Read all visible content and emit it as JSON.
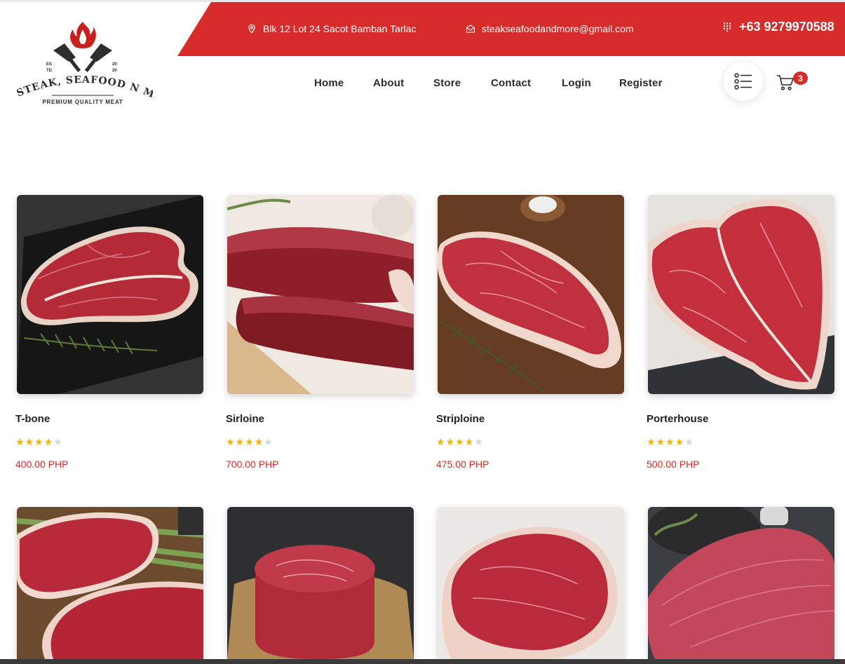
{
  "topbar": {
    "address": "Blk 12 Lot 24 Sacot Bamban Tarlac",
    "email": "steakseafoodandmore@gmail.com",
    "phone": "+63 9279970588"
  },
  "logo": {
    "brand": "STEAK, SEAFOOD N MORE",
    "tagline": "PREMIUM QUALITY MEAT",
    "est_left": "ES\nTD",
    "est_right": "20\n20"
  },
  "nav": {
    "items": [
      "Home",
      "About",
      "Store",
      "Contact",
      "Login",
      "Register"
    ]
  },
  "cart": {
    "count": "3"
  },
  "colors": {
    "accent": "#d82b2b",
    "star": "#f5b400",
    "star_empty": "#d6d6d6"
  },
  "products": [
    {
      "name": "T-bone",
      "rating": 4,
      "max_rating": 5,
      "price": "400.00 PHP"
    },
    {
      "name": "Sirloine",
      "rating": 4,
      "max_rating": 5,
      "price": "700.00 PHP"
    },
    {
      "name": "Striploine",
      "rating": 4,
      "max_rating": 5,
      "price": "475.00 PHP"
    },
    {
      "name": "Porterhouse",
      "rating": 4,
      "max_rating": 5,
      "price": "500.00 PHP"
    }
  ],
  "icons": [
    "location-pin-icon",
    "mail-icon",
    "phone-dialpad-icon",
    "list-menu-icon",
    "cart-icon",
    "star-icon"
  ]
}
